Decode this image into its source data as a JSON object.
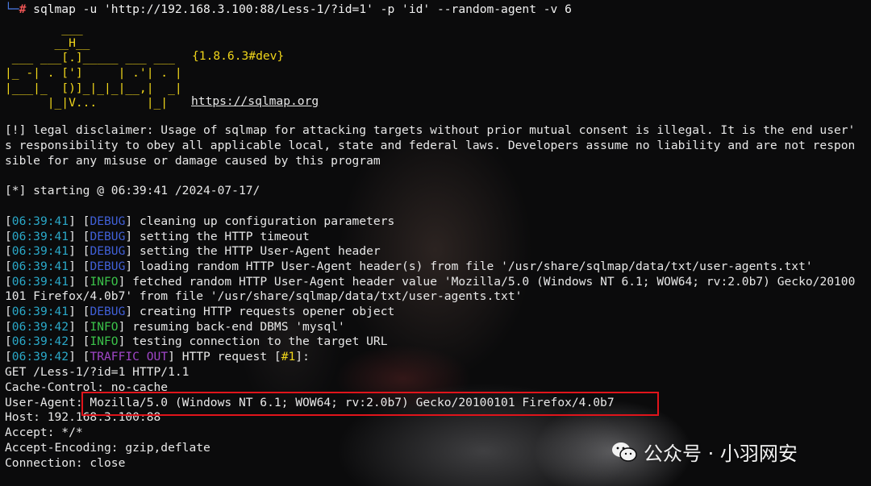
{
  "prompt": {
    "mark": "└─",
    "hash": "#",
    "command": " sqlmap -u 'http://192.168.3.100:88/Less-1/?id=1' -p 'id' --random-agent -v 6"
  },
  "banner": {
    "logo_lines": [
      "        ___",
      "       __H__",
      " ___ ___[.]_____ ___ ___  ",
      "|_ -| . [']     | .'| . | ",
      "|___|_  [)]_|_|_|__,|  _| ",
      "      |_|V...       |_|   "
    ],
    "version": "{1.8.6.3#dev}",
    "site_url": "https://sqlmap.org"
  },
  "disclaimer": [
    "[!] legal disclaimer: Usage of sqlmap for attacking targets without prior mutual consent is illegal. It is the end user'",
    "s responsibility to obey all applicable local, state and federal laws. Developers assume no liability and are not respon",
    "sible for any misuse or damage caused by this program"
  ],
  "starting": "[*] starting @ 06:39:41 /2024-07-17/",
  "log": [
    {
      "time": "06:39:41",
      "level": "DEBUG",
      "text": " cleaning up configuration parameters"
    },
    {
      "time": "06:39:41",
      "level": "DEBUG",
      "text": " setting the HTTP timeout"
    },
    {
      "time": "06:39:41",
      "level": "DEBUG",
      "text": " setting the HTTP User-Agent header"
    },
    {
      "time": "06:39:41",
      "level": "DEBUG",
      "text": " loading random HTTP User-Agent header(s) from file '/usr/share/sqlmap/data/txt/user-agents.txt'"
    },
    {
      "time": "06:39:41",
      "level": "INFO",
      "text": " fetched random HTTP User-Agent header value 'Mozilla/5.0 (Windows NT 6.1; WOW64; rv:2.0b7) Gecko/20100"
    },
    {
      "time": "",
      "level": "",
      "text": "101 Firefox/4.0b7' from file '/usr/share/sqlmap/data/txt/user-agents.txt'"
    },
    {
      "time": "06:39:41",
      "level": "DEBUG",
      "text": " creating HTTP requests opener object"
    },
    {
      "time": "06:39:42",
      "level": "INFO",
      "text": " resuming back-end DBMS 'mysql'"
    },
    {
      "time": "06:39:42",
      "level": "INFO",
      "text": " testing connection to the target URL"
    },
    {
      "time": "06:39:42",
      "level": "TRAFFIC OUT",
      "text": " HTTP request [",
      "reqnum": "#1",
      "tail": "]:"
    }
  ],
  "request": [
    "GET /Less-1/?id=1 HTTP/1.1",
    "Cache-Control: no-cache",
    "User-Agent: Mozilla/5.0 (Windows NT 6.1; WOW64; rv:2.0b7) Gecko/20100101 Firefox/4.0b7",
    "Host: 192.168.3.100:88",
    "Accept: */*",
    "Accept-Encoding: gzip,deflate",
    "Connection: close"
  ],
  "watermark": {
    "text": "公众号 · 小羽网安",
    "icon": "wechat-icon"
  },
  "colors": {
    "timestamp": "#2aa8c8",
    "debug": "#4060d8",
    "info": "#3bc34a",
    "traffic_out": "#a046c8",
    "logo": "#f1d61a",
    "highlight_box": "#e0141b"
  }
}
